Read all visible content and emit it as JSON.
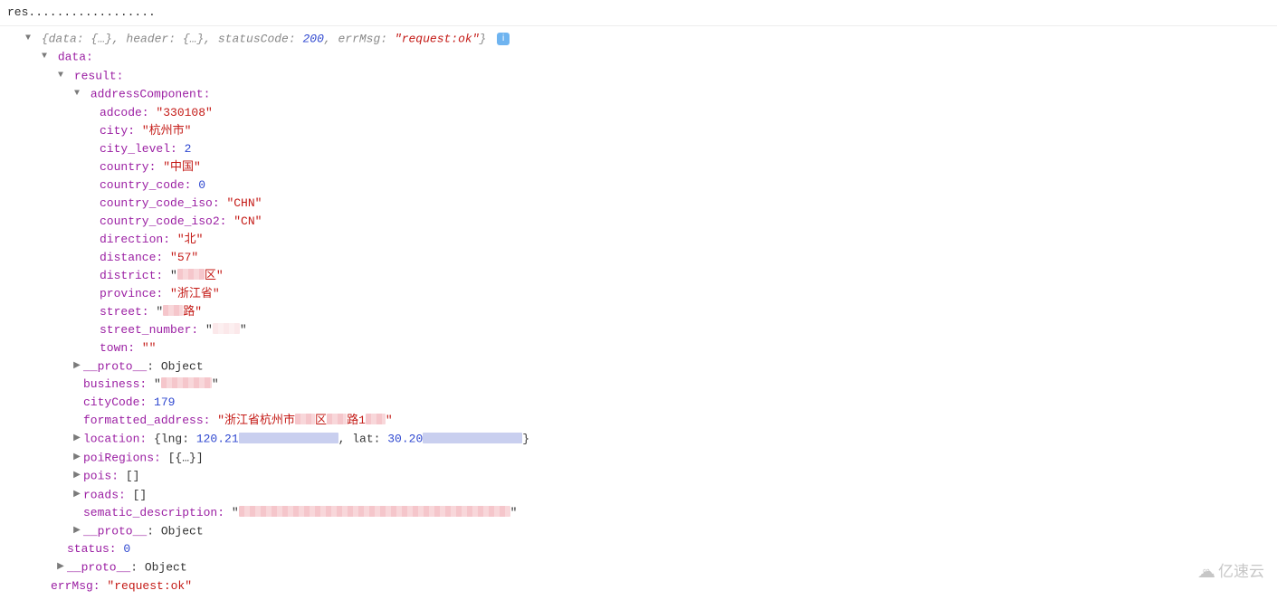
{
  "lineTop": "res..................",
  "summary": {
    "prefix": "{data: {…}, header: {…}, statusCode: ",
    "statusCode": "200",
    "mid": ", errMsg: ",
    "errMsg": "\"request:ok\"",
    "suffix": "}"
  },
  "labels": {
    "data": "data:",
    "result": "result:",
    "addressComponent": "addressComponent:",
    "adcode": "adcode: ",
    "city": "city: ",
    "city_level": "city_level: ",
    "country": "country: ",
    "country_code": "country_code: ",
    "country_code_iso": "country_code_iso: ",
    "country_code_iso2": "country_code_iso2: ",
    "direction": "direction: ",
    "distance": "distance: ",
    "district": "district: ",
    "province": "province: ",
    "street": "street: ",
    "street_number": "street_number: ",
    "town": "town: ",
    "proto": "__proto__",
    "protoVal": ": Object",
    "business": "business: ",
    "cityCode": "cityCode: ",
    "formatted_address": "formatted_address: ",
    "location": "location: ",
    "lng": "{lng: ",
    "lat": ", lat: ",
    "locEnd": "}",
    "poiRegions": "poiRegions: ",
    "poiRegionsVal": "[{…}]",
    "pois": "pois: ",
    "poisVal": "[]",
    "roads": "roads: ",
    "roadsVal": "[]",
    "sematic": "sematic_description: ",
    "status": "status: ",
    "errMsg": "errMsg: "
  },
  "vals": {
    "adcode": "\"330108\"",
    "city": "\"杭州市\"",
    "city_level": "2",
    "country": "\"中国\"",
    "country_code": "0",
    "country_code_iso": "\"CHN\"",
    "country_code_iso2": "\"CN\"",
    "direction": "\"北\"",
    "distance": "\"57\"",
    "district_suffix": "区\"",
    "province": "\"浙江省\"",
    "street_suffix": "路\"",
    "town": "\"\"",
    "cityCode": "179",
    "formatted_prefix": "\"浙江省杭州市",
    "formatted_mid1": "区",
    "formatted_mid2": "路1",
    "formatted_end": "\"",
    "lng": "120.21",
    "lat": "30.20",
    "status": "0",
    "errMsg": "\"request:ok\""
  },
  "watermark": "亿速云"
}
